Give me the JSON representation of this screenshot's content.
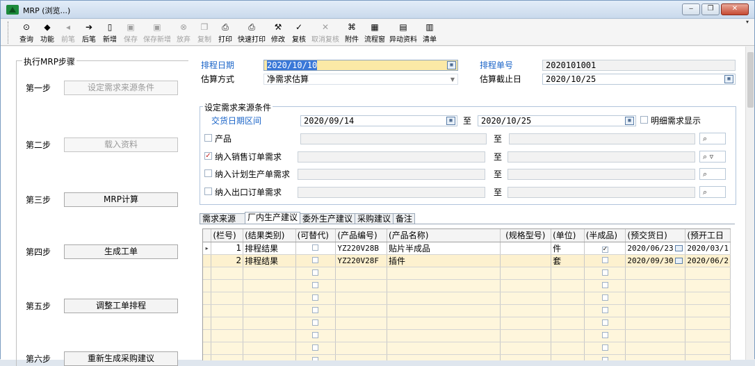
{
  "window": {
    "title": "MRP (浏览...)",
    "controls": [
      "‒",
      "❐",
      "✕"
    ]
  },
  "toolbar": {
    "buttons": [
      {
        "label": "查询",
        "icon": "query-icon",
        "glyph": "⊙",
        "enabled": true
      },
      {
        "label": "功能",
        "icon": "function-icon",
        "glyph": "◆",
        "enabled": true
      },
      {
        "label": "前笔",
        "icon": "prev-icon",
        "glyph": "◂",
        "enabled": false
      },
      {
        "label": "后笔",
        "icon": "next-icon",
        "glyph": "➔",
        "enabled": true
      },
      {
        "label": "新增",
        "icon": "new-icon",
        "glyph": "▯",
        "enabled": true
      },
      {
        "label": "保存",
        "icon": "save-icon",
        "glyph": "▣",
        "enabled": false
      },
      {
        "label": "保存新增",
        "icon": "save-new-icon",
        "glyph": "▣",
        "enabled": false
      },
      {
        "label": "放弃",
        "icon": "abandon-icon",
        "glyph": "⊗",
        "enabled": false
      },
      {
        "label": "复制",
        "icon": "copy-icon",
        "glyph": "❐",
        "enabled": false
      },
      {
        "label": "打印",
        "icon": "print-icon",
        "glyph": "⎙",
        "enabled": true
      },
      {
        "label": "快速打印",
        "icon": "quick-print-icon",
        "glyph": "⎙",
        "enabled": true
      },
      {
        "label": "修改",
        "icon": "edit-icon",
        "glyph": "⚒",
        "enabled": true
      },
      {
        "label": "复核",
        "icon": "review-icon",
        "glyph": "✓",
        "enabled": true
      },
      {
        "label": "取消复核",
        "icon": "cancel-review-icon",
        "glyph": "✕",
        "enabled": false
      },
      {
        "label": "附件",
        "icon": "attachment-icon",
        "glyph": "⌘",
        "enabled": true
      },
      {
        "label": "流程窗",
        "icon": "flow-window-icon",
        "glyph": "▦",
        "enabled": true
      },
      {
        "label": "异动资料",
        "icon": "change-data-icon",
        "glyph": "▤",
        "enabled": true
      },
      {
        "label": "清单",
        "icon": "list-icon",
        "glyph": "▥",
        "enabled": true
      }
    ],
    "more": "▾"
  },
  "steps": {
    "legend": "执行MRP步骤",
    "items": [
      {
        "step": "第一步",
        "label": "设定需求来源条件",
        "enabled": false
      },
      {
        "step": "第二步",
        "label": "载入资料",
        "enabled": false
      },
      {
        "step": "第三步",
        "label": "MRP计算",
        "enabled": true
      },
      {
        "step": "第四步",
        "label": "生成工单",
        "enabled": true
      },
      {
        "step": "第五步",
        "label": "调整工单排程",
        "enabled": true
      },
      {
        "step": "第六步",
        "label": "重新生成采购建议",
        "enabled": true
      }
    ]
  },
  "header": {
    "schedule_date_label": "排程日期",
    "schedule_date": "2020/10/10",
    "schedule_no_label": "排程单号",
    "schedule_no": "2020101001",
    "estimate_method_label": "估算方式",
    "estimate_method": "净需求估算",
    "estimate_end_label": "估算截止日",
    "estimate_end": "2020/10/25"
  },
  "conditions": {
    "legend": "设定需求来源条件",
    "delivery_range_label": "交货日期区间",
    "delivery_from": "2020/09/14",
    "to": "至",
    "delivery_to": "2020/10/25",
    "detail_display_label": "明细需求显示",
    "product_label": "产品",
    "sales_order_label": "纳入销售订单需求",
    "plan_order_label": "纳入计划生产单需求",
    "export_order_label": "纳入出口订单需求",
    "check_mark": "✓",
    "binoculars": "⌕",
    "filter_mark": "▿"
  },
  "tabs": [
    "需求来源",
    "厂内生产建议",
    "委外生产建议",
    "采购建议",
    "备注"
  ],
  "grid": {
    "columns": [
      "(栏号)",
      "(结果类别)",
      "(可替代)",
      "(产品编号)",
      "(产品名称)",
      "(规格型号)",
      "(单位)",
      "(半成品)",
      "(预交货日)",
      "(预开工日"
    ],
    "rows": [
      {
        "no": "1",
        "type": "排程结果",
        "code": "YZ220V28B",
        "name": "贴片半成品",
        "spec": "",
        "unit": "件",
        "semi": "✓",
        "due": "2020/06/23",
        "start": "2020/03/1"
      },
      {
        "no": "2",
        "type": "排程结果",
        "code": "YZ220V28F",
        "name": "插件",
        "spec": "",
        "unit": "套",
        "semi": "",
        "due": "2020/09/30",
        "start": "2020/06/2"
      }
    ],
    "row_pointer": "▸"
  }
}
